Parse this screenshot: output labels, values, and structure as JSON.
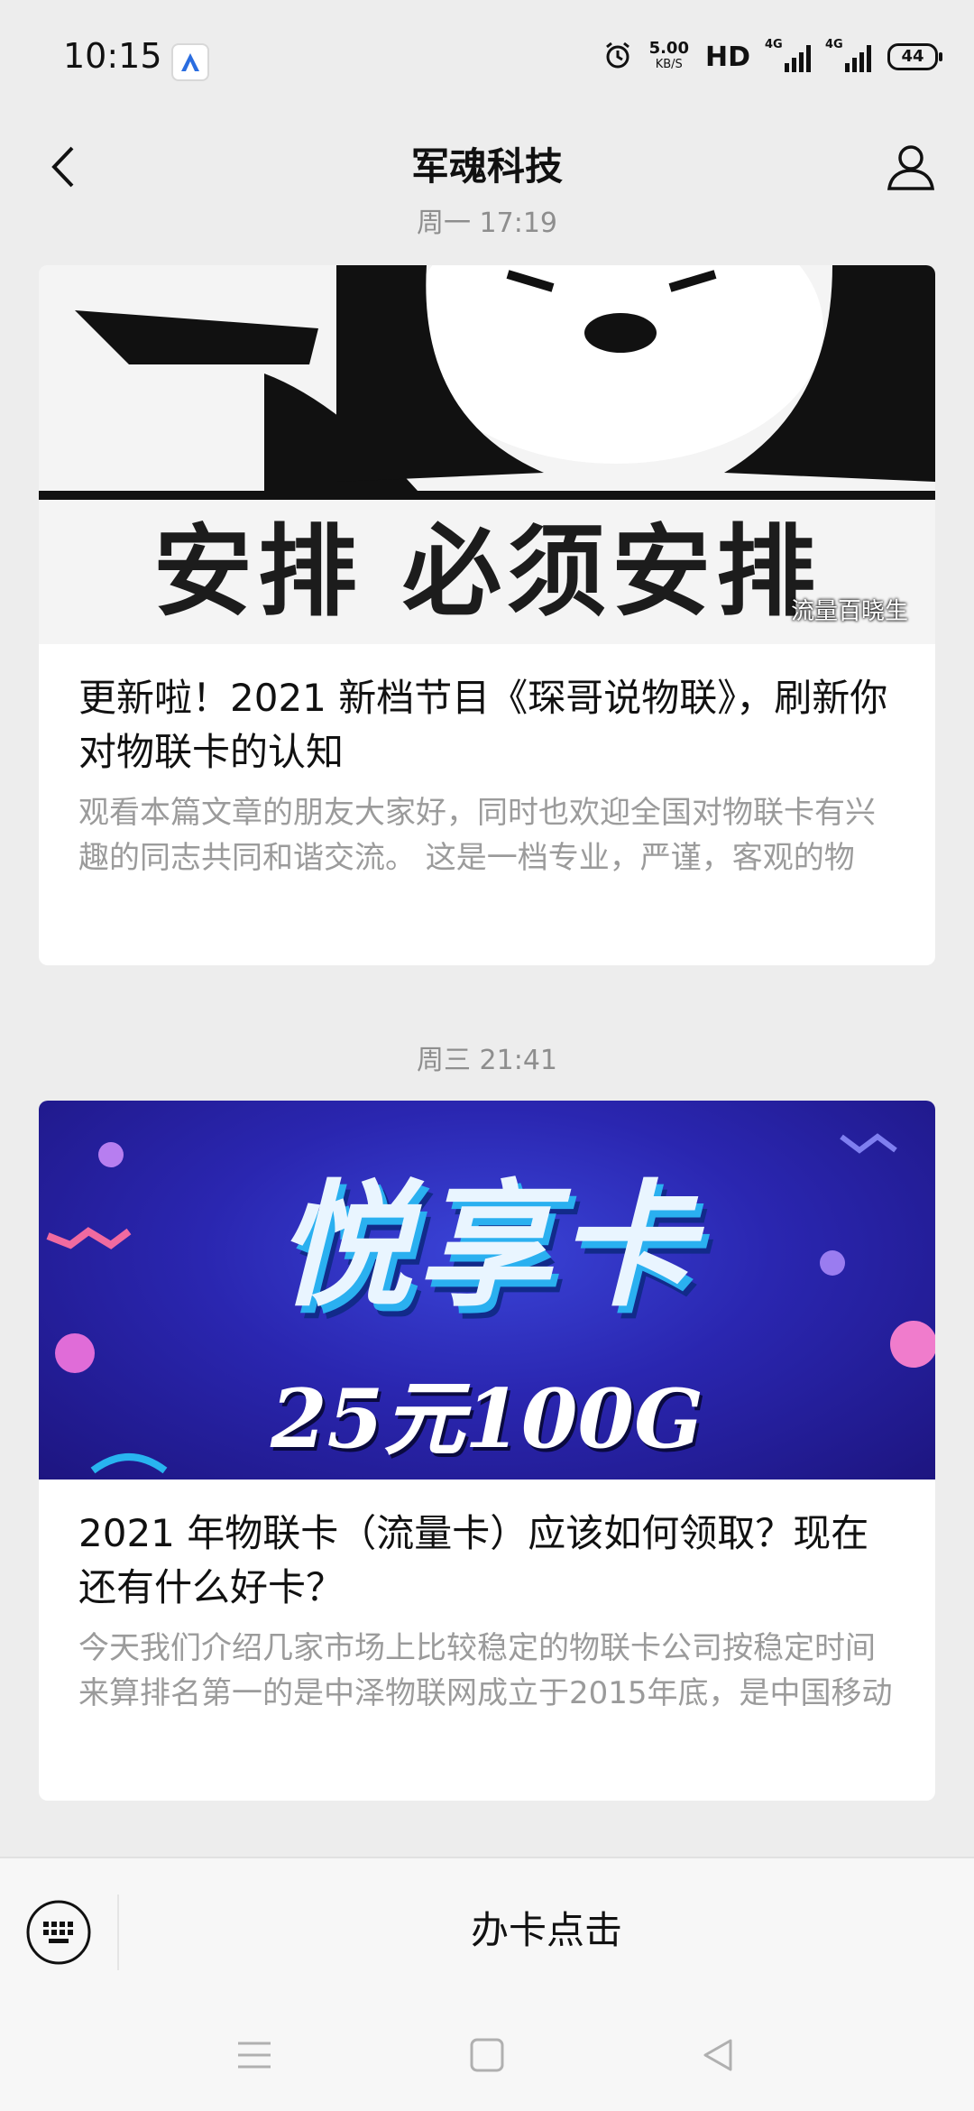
{
  "status_bar": {
    "time": "10:15",
    "speed_value": "5.00",
    "speed_unit": "KB/S",
    "hd_label": "HD",
    "network1": "4G",
    "network2": "4G",
    "battery": "44"
  },
  "header": {
    "title": "军魂科技"
  },
  "feed": [
    {
      "time": "周一 17:19",
      "cover_caption": "安排 必须安排",
      "cover_watermark": "流量百晓生",
      "headline": "更新啦！2021 新档节目《琛哥说物联》，刷新你对物联卡的认知",
      "summary": "观看本篇文章的朋友大家好，同时也欢迎全国对物联卡有兴趣的同志共同和谐交流。  这是一档专业，严谨，客观的物"
    },
    {
      "time": "周三 21:41",
      "cover_title": "悦享卡",
      "cover_price": "25元100G",
      "headline": "2021 年物联卡（流量卡）应该如何领取？现在还有什么好卡？",
      "summary": "今天我们介绍几家市场上比较稳定的物联卡公司按稳定时间来算排名第一的是中泽物联网成立于2015年底，是中国移动"
    }
  ],
  "bottom_menu": {
    "keyboard_icon": "keyboard-icon",
    "item_label": "办卡点击"
  },
  "nav": {
    "icons": [
      "menu-icon",
      "home-icon",
      "back-triangle-icon"
    ]
  },
  "colors": {
    "background": "#ededed",
    "card": "#ffffff",
    "muted_text": "#9b9b9b",
    "cover2_blue": "#2a26b0"
  }
}
